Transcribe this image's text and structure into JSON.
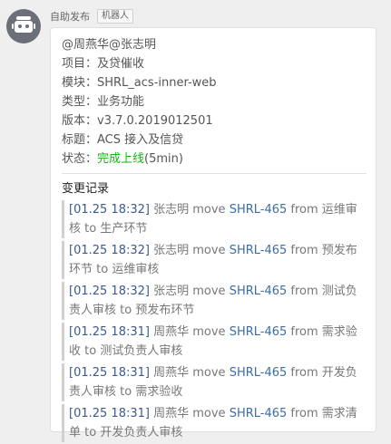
{
  "sender": {
    "name": "自助发布",
    "badge": "机器人"
  },
  "message": {
    "mentions": "@周燕华@张志明",
    "project": "项目：及贷催收",
    "module": "模块：SHRL_acs-inner-web",
    "type": "类型：业务功能",
    "version": "版本：v3.7.0.2019012501",
    "subject": "标题：ACS 接入及信贷",
    "status_label": "状态：",
    "status_value": "完成上线",
    "status_duration": "(5min)",
    "changelog_title": "变更记录",
    "logs": [
      {
        "line1": [
          "[01.25 18:32]",
          " 张志明 move ",
          "SHRL-465",
          " from 运维审"
        ],
        "line2": "核 to 生产环节"
      },
      {
        "line1": [
          "[01.25 18:32]",
          " 张志明 move ",
          "SHRL-465",
          " from 预发布"
        ],
        "line2": "环节 to 运维审核"
      },
      {
        "line1": [
          "[01.25 18:32]",
          " 张志明 move ",
          "SHRL-465",
          " from 测试负"
        ],
        "line2": "责人审核 to 预发布环节"
      },
      {
        "line1": [
          "[01.25 18:31]",
          " 周燕华 move ",
          "SHRL-465",
          " from 需求验"
        ],
        "line2": "收 to 测试负责人审核"
      },
      {
        "line1": [
          "[01.25 18:31]",
          " 周燕华 move ",
          "SHRL-465",
          " from 开发负"
        ],
        "line2": "责人审核 to 需求验收"
      },
      {
        "line1": [
          "[01.25 18:31]",
          " 周燕华 move ",
          "SHRL-465",
          " from 需求清"
        ],
        "line2": "单 to 开发负责人审核"
      }
    ]
  }
}
